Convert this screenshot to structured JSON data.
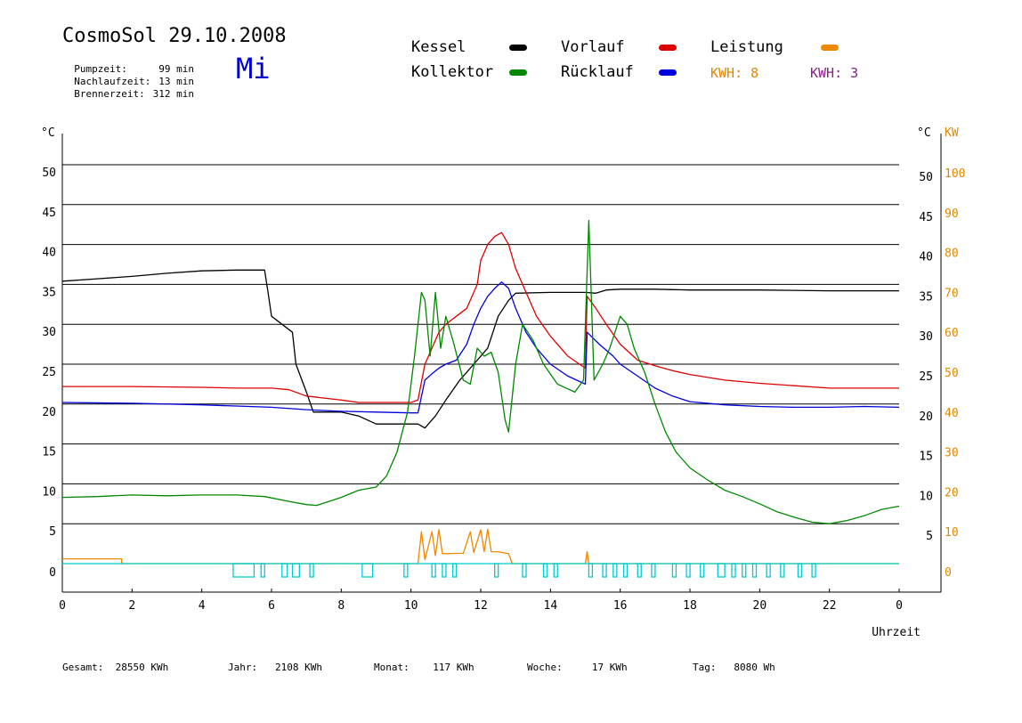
{
  "header": {
    "title": "CosmoSol 29.10.2008",
    "day": "Mi",
    "stats": [
      {
        "label": "Pumpzeit:",
        "value": "99 min"
      },
      {
        "label": "Nachlaufzeit:",
        "value": "13 min"
      },
      {
        "label": "Brennerzeit:",
        "value": "312 min"
      }
    ]
  },
  "legend": {
    "items": [
      {
        "label": "Kessel",
        "color": "#000000"
      },
      {
        "label": "Vorlauf",
        "color": "#dd0000"
      },
      {
        "label": "Leistung",
        "color": "#ee8800"
      },
      {
        "label": "Kollektor",
        "color": "#008800"
      },
      {
        "label": "Rücklauf",
        "color": "#0000dd"
      }
    ],
    "kwh": [
      {
        "label": "KWH: 8",
        "color": "#dd8800"
      },
      {
        "label": "KWH: 3",
        "color": "#882288"
      }
    ]
  },
  "footer": [
    {
      "label": "Gesamt:",
      "value": "28550 KWh"
    },
    {
      "label": "Jahr:",
      "value": "2108 KWh"
    },
    {
      "label": "Monat:",
      "value": "117 KWh"
    },
    {
      "label": "Woche:",
      "value": "17 KWh"
    },
    {
      "label": "Tag:",
      "value": "8080 Wh"
    }
  ],
  "chart_data": {
    "type": "line",
    "xlabel": "Uhrzeit",
    "ylabel_left": "°C",
    "ylabel_right": [
      "°C",
      "KW"
    ],
    "xlim": [
      0,
      24
    ],
    "ylim": [
      0,
      50
    ],
    "ylim_right_kw": [
      0,
      100
    ],
    "x_ticks": [
      "0",
      "2",
      "4",
      "6",
      "8",
      "10",
      "12",
      "14",
      "16",
      "18",
      "20",
      "22",
      "0"
    ],
    "y_ticks_left": [
      "0",
      "5",
      "10",
      "15",
      "20",
      "25",
      "30",
      "35",
      "40",
      "45",
      "50"
    ],
    "y_ticks_right": [
      "5",
      "10",
      "15",
      "20",
      "25",
      "30",
      "35",
      "40",
      "45",
      "50"
    ],
    "y_ticks_kw": [
      "0",
      "10",
      "20",
      "30",
      "40",
      "50",
      "60",
      "70",
      "80",
      "90",
      "100"
    ],
    "grid": true,
    "series": [
      {
        "name": "Kessel",
        "color": "#000000",
        "points": [
          [
            0,
            35.4
          ],
          [
            1,
            35.7
          ],
          [
            2,
            36
          ],
          [
            3,
            36.4
          ],
          [
            4,
            36.7
          ],
          [
            5,
            36.8
          ],
          [
            5.8,
            36.8
          ],
          [
            5.9,
            34
          ],
          [
            6,
            31
          ],
          [
            6.3,
            30
          ],
          [
            6.6,
            29
          ],
          [
            6.7,
            25
          ],
          [
            7,
            21.5
          ],
          [
            7.2,
            19
          ],
          [
            8,
            19
          ],
          [
            8.5,
            18.5
          ],
          [
            9,
            17.5
          ],
          [
            9.8,
            17.5
          ],
          [
            10.2,
            17.5
          ],
          [
            10.4,
            17
          ],
          [
            10.7,
            18.5
          ],
          [
            11,
            20.5
          ],
          [
            11.4,
            23
          ],
          [
            11.8,
            25
          ],
          [
            12.2,
            27
          ],
          [
            12.5,
            31
          ],
          [
            12.8,
            33
          ],
          [
            13,
            33.9
          ],
          [
            14,
            34
          ],
          [
            15,
            34
          ],
          [
            15.3,
            33.9
          ],
          [
            15.6,
            34.3
          ],
          [
            16,
            34.4
          ],
          [
            17,
            34.4
          ],
          [
            18,
            34.3
          ],
          [
            19,
            34.3
          ],
          [
            20,
            34.3
          ],
          [
            22,
            34.2
          ],
          [
            24,
            34.2
          ]
        ]
      },
      {
        "name": "Vorlauf",
        "color": "#dd0000",
        "points": [
          [
            0,
            22.2
          ],
          [
            2,
            22.2
          ],
          [
            4,
            22.1
          ],
          [
            5,
            22
          ],
          [
            6,
            22
          ],
          [
            6.5,
            21.8
          ],
          [
            7,
            21
          ],
          [
            8,
            20.5
          ],
          [
            8.5,
            20.2
          ],
          [
            9,
            20.2
          ],
          [
            10,
            20.2
          ],
          [
            10.2,
            20.5
          ],
          [
            10.4,
            25
          ],
          [
            10.6,
            27
          ],
          [
            10.8,
            29
          ],
          [
            11,
            30
          ],
          [
            11.3,
            31
          ],
          [
            11.6,
            32
          ],
          [
            11.9,
            35
          ],
          [
            12,
            38
          ],
          [
            12.2,
            40
          ],
          [
            12.4,
            41
          ],
          [
            12.6,
            41.5
          ],
          [
            12.8,
            40
          ],
          [
            13,
            37
          ],
          [
            13.3,
            34
          ],
          [
            13.6,
            31
          ],
          [
            14,
            28.5
          ],
          [
            14.5,
            26
          ],
          [
            15,
            24.5
          ],
          [
            15.05,
            33.5
          ],
          [
            15.3,
            32
          ],
          [
            15.6,
            30
          ],
          [
            16,
            27.5
          ],
          [
            16.5,
            25.5
          ],
          [
            17,
            24.8
          ],
          [
            17.5,
            24.2
          ],
          [
            18,
            23.7
          ],
          [
            19,
            23
          ],
          [
            20,
            22.6
          ],
          [
            21,
            22.3
          ],
          [
            22,
            22
          ],
          [
            23,
            22
          ],
          [
            24,
            22
          ]
        ]
      },
      {
        "name": "Rücklauf",
        "color": "#0000dd",
        "points": [
          [
            0,
            20.2
          ],
          [
            2,
            20.1
          ],
          [
            4,
            19.9
          ],
          [
            6,
            19.6
          ],
          [
            7,
            19.3
          ],
          [
            8,
            19.1
          ],
          [
            9,
            19
          ],
          [
            10,
            18.9
          ],
          [
            10.2,
            18.9
          ],
          [
            10.4,
            23
          ],
          [
            10.6,
            23.8
          ],
          [
            10.8,
            24.5
          ],
          [
            11,
            25
          ],
          [
            11.3,
            25.5
          ],
          [
            11.6,
            27.5
          ],
          [
            11.8,
            30
          ],
          [
            12,
            32
          ],
          [
            12.2,
            33.5
          ],
          [
            12.4,
            34.5
          ],
          [
            12.6,
            35.3
          ],
          [
            12.8,
            34.5
          ],
          [
            13,
            32
          ],
          [
            13.3,
            29
          ],
          [
            13.6,
            27
          ],
          [
            14,
            25
          ],
          [
            14.5,
            23.5
          ],
          [
            15,
            22.5
          ],
          [
            15.05,
            29
          ],
          [
            15.4,
            27.5
          ],
          [
            15.8,
            26
          ],
          [
            16,
            25
          ],
          [
            16.5,
            23.5
          ],
          [
            17,
            22
          ],
          [
            17.5,
            21
          ],
          [
            18,
            20.3
          ],
          [
            19,
            19.9
          ],
          [
            20,
            19.7
          ],
          [
            21,
            19.6
          ],
          [
            22,
            19.6
          ],
          [
            23,
            19.7
          ],
          [
            24,
            19.6
          ]
        ]
      },
      {
        "name": "Kollektor",
        "color": "#008800",
        "points": [
          [
            0,
            8.3
          ],
          [
            1,
            8.4
          ],
          [
            2,
            8.6
          ],
          [
            3,
            8.5
          ],
          [
            4,
            8.6
          ],
          [
            5,
            8.6
          ],
          [
            5.8,
            8.4
          ],
          [
            6.5,
            7.8
          ],
          [
            7,
            7.4
          ],
          [
            7.3,
            7.3
          ],
          [
            8,
            8.3
          ],
          [
            8.5,
            9.2
          ],
          [
            9,
            9.6
          ],
          [
            9.3,
            11
          ],
          [
            9.6,
            14
          ],
          [
            9.9,
            19
          ],
          [
            10.1,
            26
          ],
          [
            10.3,
            34
          ],
          [
            10.4,
            33
          ],
          [
            10.55,
            26
          ],
          [
            10.7,
            34
          ],
          [
            10.85,
            27
          ],
          [
            11,
            31
          ],
          [
            11.2,
            28
          ],
          [
            11.5,
            23
          ],
          [
            11.7,
            22.5
          ],
          [
            11.9,
            27
          ],
          [
            12.1,
            26
          ],
          [
            12.3,
            26.5
          ],
          [
            12.5,
            24
          ],
          [
            12.7,
            18
          ],
          [
            12.8,
            16.5
          ],
          [
            13,
            25
          ],
          [
            13.2,
            30
          ],
          [
            13.5,
            28
          ],
          [
            13.8,
            25
          ],
          [
            14.2,
            22.5
          ],
          [
            14.7,
            21.5
          ],
          [
            14.95,
            23
          ],
          [
            15.1,
            43
          ],
          [
            15.25,
            23
          ],
          [
            15.5,
            25
          ],
          [
            15.7,
            27
          ],
          [
            16,
            31
          ],
          [
            16.2,
            30
          ],
          [
            16.4,
            27
          ],
          [
            16.7,
            24
          ],
          [
            17,
            20
          ],
          [
            17.3,
            16.5
          ],
          [
            17.6,
            14
          ],
          [
            18,
            12
          ],
          [
            18.5,
            10.5
          ],
          [
            19,
            9.2
          ],
          [
            19.5,
            8.4
          ],
          [
            20,
            7.5
          ],
          [
            20.5,
            6.5
          ],
          [
            21,
            5.8
          ],
          [
            21.5,
            5.2
          ],
          [
            22,
            5
          ],
          [
            22.5,
            5.4
          ],
          [
            23,
            6
          ],
          [
            23.5,
            6.8
          ],
          [
            24,
            7.2
          ]
        ]
      },
      {
        "name": "Leistung",
        "color": "#ee8800",
        "axis": "right",
        "points": [
          [
            0,
            1.2
          ],
          [
            1.7,
            1.2
          ],
          [
            1.7,
            0
          ],
          [
            10.2,
            0
          ],
          [
            10.3,
            8
          ],
          [
            10.4,
            1
          ],
          [
            10.6,
            8
          ],
          [
            10.7,
            2
          ],
          [
            10.8,
            8.5
          ],
          [
            10.9,
            2.5
          ],
          [
            11,
            2.5
          ],
          [
            11.5,
            2.6
          ],
          [
            11.7,
            8
          ],
          [
            11.8,
            2.8
          ],
          [
            12,
            8.5
          ],
          [
            12.1,
            3
          ],
          [
            12.2,
            8.6
          ],
          [
            12.3,
            3
          ],
          [
            12.5,
            3
          ],
          [
            12.8,
            2.5
          ],
          [
            12.9,
            0
          ],
          [
            15,
            0
          ],
          [
            15.05,
            3
          ],
          [
            15.1,
            0
          ],
          [
            24,
            0
          ]
        ]
      },
      {
        "name": "Pumpe",
        "color": "#00cccc",
        "points": [
          [
            0,
            0
          ],
          [
            24,
            0
          ]
        ]
      }
    ]
  }
}
